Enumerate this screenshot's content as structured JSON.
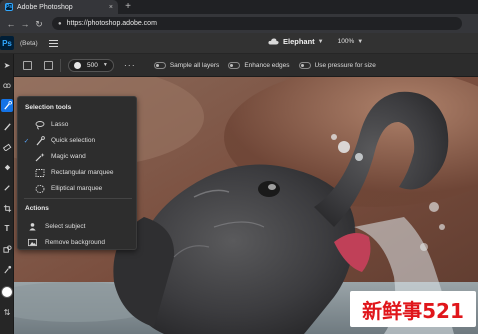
{
  "browser": {
    "tab_title": "Adobe Photoshop",
    "tab_close": "×",
    "new_tab": "+",
    "back": "←",
    "forward": "→",
    "reload": "↻",
    "url": "https://photoshop.adobe.com"
  },
  "app": {
    "logo": "Ps",
    "beta": "(Beta)",
    "document_name": "Elephant",
    "zoom": "100%"
  },
  "options": {
    "brush_size": "500",
    "more": "···",
    "toggles": [
      {
        "label": "Sample all layers"
      },
      {
        "label": "Enhance edges"
      },
      {
        "label": "Use pressure for size"
      }
    ]
  },
  "flyout": {
    "section_tools": "Selection tools",
    "tools": [
      {
        "label": "Lasso",
        "icon": "lasso-icon",
        "checked": false
      },
      {
        "label": "Quick selection",
        "icon": "quick-selection-icon",
        "checked": true
      },
      {
        "label": "Magic wand",
        "icon": "magic-wand-icon",
        "checked": false
      },
      {
        "label": "Rectangular marquee",
        "icon": "rectangular-marquee-icon",
        "checked": false
      },
      {
        "label": "Elliptical marquee",
        "icon": "elliptical-marquee-icon",
        "checked": false
      }
    ],
    "check_mark": "✓",
    "section_actions": "Actions",
    "actions": [
      {
        "label": "Select subject",
        "icon": "select-subject-icon"
      },
      {
        "label": "Remove background",
        "icon": "remove-background-icon"
      }
    ]
  },
  "toolbar": {
    "tools": [
      "move-icon",
      "lasso-icon",
      "quick-selection-icon",
      "brush-icon",
      "eraser-icon",
      "fill-icon",
      "dropper-icon",
      "crop-icon",
      "type-icon",
      "shape-icon",
      "eyedropper-icon"
    ]
  },
  "watermark": "新鲜事521",
  "colors": {
    "accent": "#1473e6",
    "ps_blue": "#31a8ff",
    "watermark_red": "#e0161b"
  }
}
